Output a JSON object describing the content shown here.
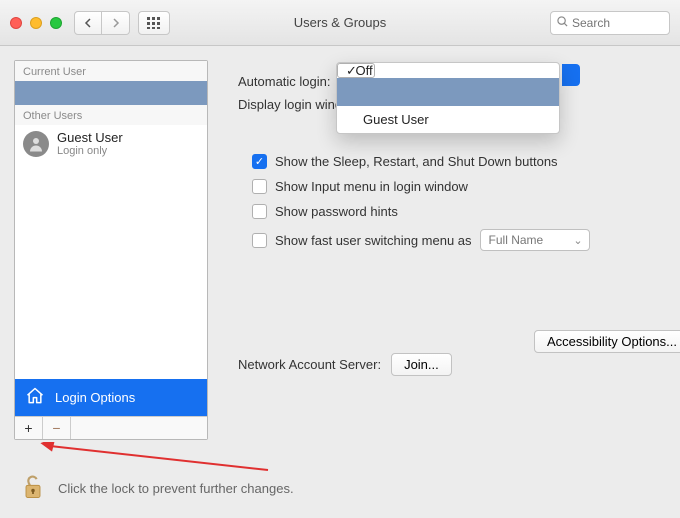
{
  "window": {
    "title": "Users & Groups",
    "search_placeholder": "Search"
  },
  "sidebar": {
    "current_header": "Current User",
    "other_header": "Other Users",
    "guest": {
      "name": "Guest User",
      "sub": "Login only"
    },
    "login_options_label": "Login Options",
    "add_label": "+",
    "remove_label": "−"
  },
  "settings": {
    "automatic_login_label": "Automatic login:",
    "display_login_label": "Display login window as:",
    "show_sleep_label": "Show the Sleep, Restart, and Shut Down buttons",
    "show_input_label": "Show Input menu in login window",
    "show_hints_label": "Show password hints",
    "fast_switch_label": "Show fast user switching menu as",
    "fast_switch_value": "Full Name",
    "accessibility_label": "Accessibility Options...",
    "network_server_label": "Network Account Server:",
    "join_label": "Join..."
  },
  "dropdown": {
    "off": "Off",
    "guest": "Guest User"
  },
  "lock": {
    "text": "Click the lock to prevent further changes."
  }
}
